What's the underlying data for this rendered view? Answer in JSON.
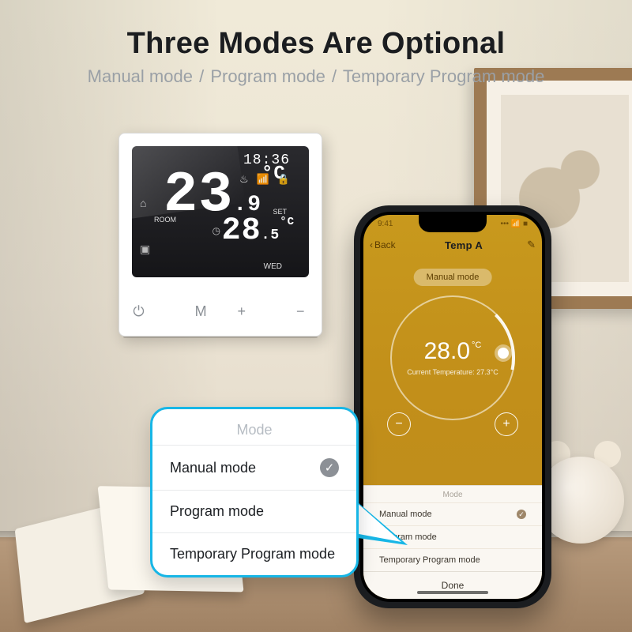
{
  "heading": {
    "title": "Three Modes Are Optional",
    "modes": [
      "Manual mode",
      "Program mode",
      "Temporary Program mode"
    ],
    "separator": "/"
  },
  "thermostat": {
    "time": "18:36",
    "room_label": "ROOM",
    "room_temp_int": "23",
    "room_temp_dec": ".9",
    "room_temp_unit": "°C",
    "set_label": "SET",
    "set_temp_int": "28",
    "set_temp_dec": ".5",
    "set_temp_unit": "°C",
    "day": "WED",
    "buttons": {
      "power": "⏻",
      "mode": "M",
      "plus": "+",
      "minus": "−"
    },
    "status_icons": [
      "flame-icon",
      "wifi-icon",
      "lock-icon"
    ]
  },
  "phone": {
    "status_time": "9:41",
    "back": "Back",
    "title": "Temp A",
    "mode_chip": "Manual mode",
    "set_temp": "28.0",
    "set_temp_unit": "°C",
    "current_label": "Current Temperature:",
    "current_temp": "27.3°C",
    "sheet": {
      "title": "Mode",
      "options": [
        "Manual mode",
        "Program mode",
        "Temporary Program mode"
      ],
      "selected_index": 0,
      "done": "Done"
    }
  },
  "callout": {
    "title": "Mode",
    "options": [
      "Manual mode",
      "Program mode",
      "Temporary Program mode"
    ],
    "selected_index": 0
  },
  "accent_color": "#17b6e6"
}
